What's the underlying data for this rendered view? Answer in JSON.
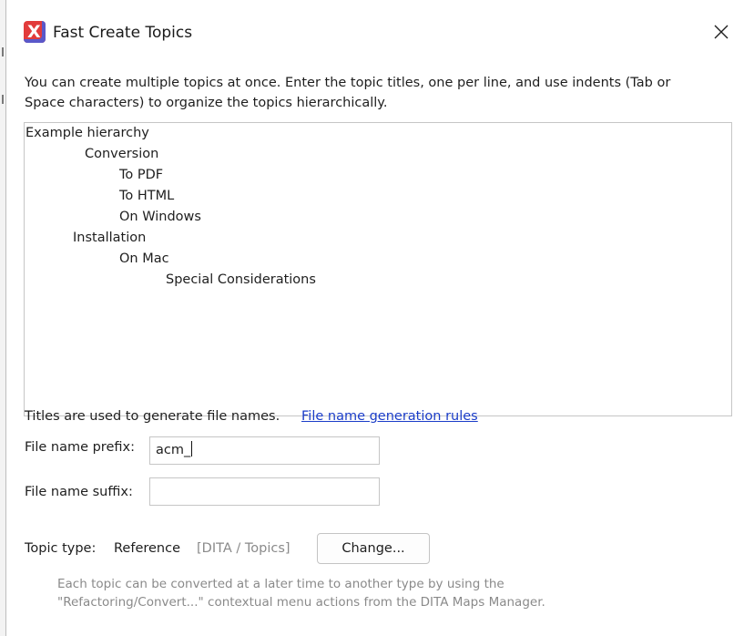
{
  "window": {
    "title": "Fast Create Topics",
    "app_icon": "oxygen-x-icon",
    "close_icon": "close-icon"
  },
  "intro": {
    "line1": "You can create multiple topics at once. Enter the topic titles, one per line, and use indents (Tab or",
    "line2": "Space characters) to organize the topics hierarchically."
  },
  "topics_area": {
    "lines": [
      {
        "text": "Example hierarchy",
        "level": 0
      },
      {
        "text": "Conversion",
        "level": 1
      },
      {
        "text": "To PDF",
        "level": 2
      },
      {
        "text": "To HTML",
        "level": 2
      },
      {
        "text": "On Windows",
        "level": 2
      },
      {
        "text": "Installation",
        "level": 1
      },
      {
        "text": "On Mac",
        "level": 2
      },
      {
        "text": "Special Considerations",
        "level": 3
      }
    ]
  },
  "filename_note": {
    "text": "Titles are used to generate file names.",
    "link": "File name generation rules"
  },
  "prefix": {
    "label": "File name prefix:",
    "value": "acm_"
  },
  "suffix": {
    "label": "File name suffix:",
    "value": ""
  },
  "topic_type": {
    "label": "Topic type:",
    "value": "Reference",
    "path": "[DITA / Topics]",
    "change_button": "Change..."
  },
  "hint": {
    "line1": "Each topic can be converted at a later time to another type by using the",
    "line2": "\"Refactoring/Convert...\" contextual menu actions from the DITA Maps Manager."
  }
}
